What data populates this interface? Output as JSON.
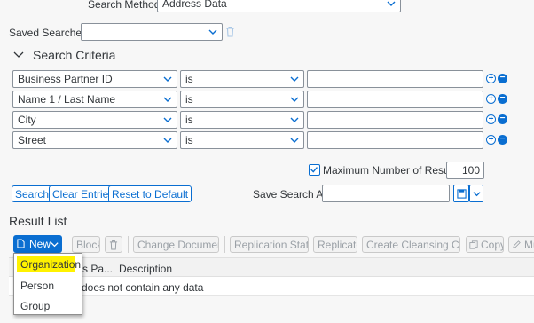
{
  "search": {
    "method_label": "Search Method:",
    "method_value": "Address Data",
    "saved_label": "Saved Searches:",
    "saved_value": ""
  },
  "criteria": {
    "title": "Search Criteria",
    "rows": [
      {
        "field": "Business Partner ID",
        "op": "is",
        "value": ""
      },
      {
        "field": "Name 1 / Last Name",
        "op": "is",
        "value": ""
      },
      {
        "field": "City",
        "op": "is",
        "value": ""
      },
      {
        "field": "Street",
        "op": "is",
        "value": ""
      }
    ],
    "max_results_checked": true,
    "max_results_label": "Maximum Number of Results:",
    "max_results_value": "100"
  },
  "actions": {
    "search": "Search",
    "clear": "Clear Entries",
    "reset": "Reset to Default",
    "save_as_label": "Save Search As:",
    "save_as_value": ""
  },
  "result": {
    "title": "Result List",
    "toolbar": {
      "new": "New",
      "block": "Block",
      "change_docs": "Change Documents",
      "replication_status": "Replication Status",
      "replicate": "Replicate",
      "cleansing": "Create Cleansing Case",
      "copy": "Copy",
      "more": "Mu"
    },
    "columns": [
      "s Pa...",
      "Description"
    ],
    "empty_text": "does not contain any data"
  },
  "new_menu": {
    "items": [
      "Organization",
      "Person",
      "Group"
    ],
    "highlight_color": "#fff200"
  },
  "colors": {
    "accent": "#0a6ed1",
    "new_button": "#0a6ed1"
  }
}
